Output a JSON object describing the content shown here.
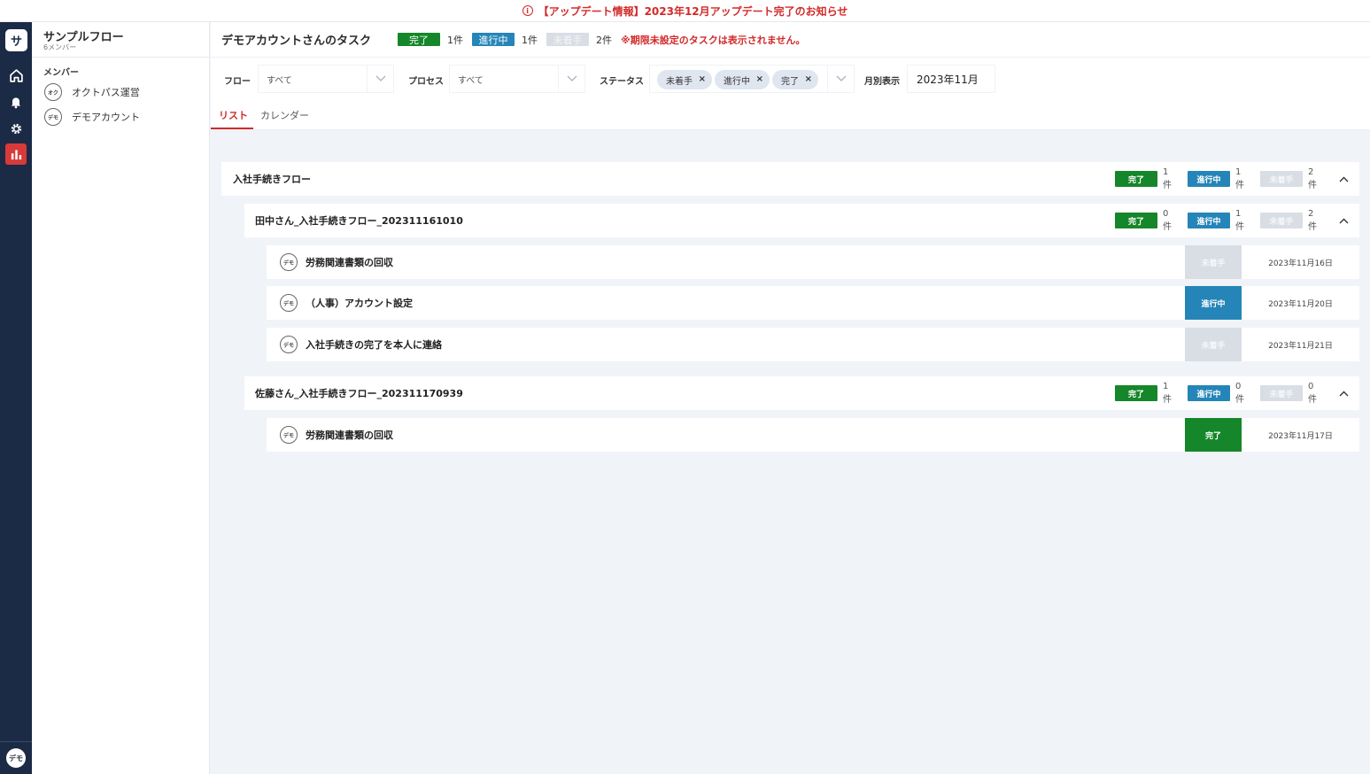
{
  "banner": {
    "text": "【アップデート情報】2023年12月アップデート完了のお知らせ"
  },
  "rail": {
    "logo": "サ",
    "avatar": "デモ",
    "items": [
      "home-icon",
      "bell-icon",
      "gear-icon",
      "chart-icon"
    ]
  },
  "sidebar": {
    "project_title": "サンプルフロー",
    "project_sub": "6メンバー",
    "section": "メンバー",
    "members": [
      {
        "avatar": "オク",
        "name": "オクトパス運営"
      },
      {
        "avatar": "デモ",
        "name": "デモアカウント"
      }
    ]
  },
  "header": {
    "title": "デモアカウントさんのタスク",
    "done_label": "完了",
    "done_count": "1件",
    "prog_label": "進行中",
    "prog_count": "1件",
    "todo_label": "未着手",
    "todo_count": "2件",
    "warning": "※期限未設定のタスクは表示されません。"
  },
  "filters": {
    "flow_label": "フロー",
    "flow_value": "すべて",
    "process_label": "プロセス",
    "process_value": "すべて",
    "status_label": "ステータス",
    "status_chips": [
      "未着手",
      "進行中",
      "完了"
    ],
    "month_label": "月別表示",
    "month_value": "2023年11月"
  },
  "tabs": [
    "リスト",
    "カレンダー"
  ],
  "labels": {
    "done": "完了",
    "prog": "進行中",
    "todo": "未着手"
  },
  "list": {
    "flow": {
      "title": "入社手続きフロー",
      "done": "1件",
      "prog": "1件",
      "todo": "2件"
    },
    "groups": [
      {
        "title": "田中さん_入社手続きフロー_202311161010",
        "done": "0件",
        "prog": "1件",
        "todo": "2件",
        "tasks": [
          {
            "avatar": "デモ",
            "title": "労務関連書類の回収",
            "status": "未着手",
            "date": "2023年11月16日"
          },
          {
            "avatar": "デモ",
            "title": "（人事）アカウント設定",
            "status": "進行中",
            "date": "2023年11月20日"
          },
          {
            "avatar": "デモ",
            "title": "入社手続きの完了を本人に連絡",
            "status": "未着手",
            "date": "2023年11月21日"
          }
        ]
      },
      {
        "title": "佐藤さん_入社手続きフロー_202311170939",
        "done": "1件",
        "prog": "0件",
        "todo": "0件",
        "tasks": [
          {
            "avatar": "デモ",
            "title": "労務関連書類の回収",
            "status": "完了",
            "date": "2023年11月17日"
          }
        ]
      }
    ]
  },
  "colors": {
    "done": "#16862a",
    "progress": "#2585b8",
    "todo": "#d9dee5",
    "accent": "#d22a2a",
    "rail": "#1b2a45"
  }
}
